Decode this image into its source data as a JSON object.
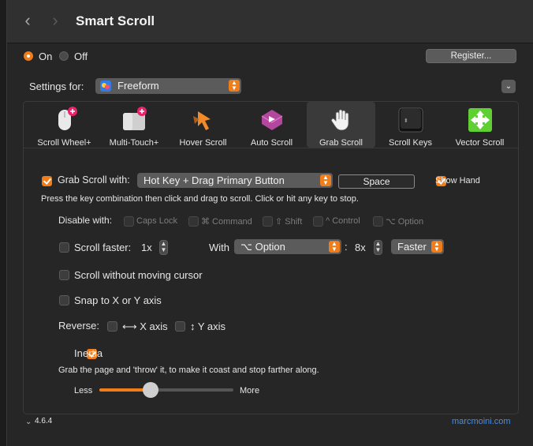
{
  "window": {
    "title": "Smart Scroll"
  },
  "nav": {
    "back": "‹",
    "forward": "›"
  },
  "power": {
    "on_label": "On",
    "off_label": "Off",
    "selected": "On"
  },
  "register_button": "Register...",
  "settings_for": {
    "label": "Settings for:",
    "app": "Freeform"
  },
  "tabs": [
    {
      "label": "Scroll Wheel+",
      "icon": "mouse-icon"
    },
    {
      "label": "Multi-Touch+",
      "icon": "trackpad-icon"
    },
    {
      "label": "Hover Scroll",
      "icon": "hover-arrow-icon"
    },
    {
      "label": "Auto Scroll",
      "icon": "auto-scroll-icon"
    },
    {
      "label": "Grab Scroll",
      "icon": "hand-icon",
      "selected": true
    },
    {
      "label": "Scroll Keys",
      "icon": "key-icon"
    },
    {
      "label": "Vector Scroll",
      "icon": "vector-arrows-icon"
    }
  ],
  "grab": {
    "enable_label": "Grab Scroll with:",
    "method": "Hot Key + Drag Primary Button",
    "hotkey": "Space",
    "show_hand_label": "Show Hand",
    "description": "Press the key combination then click and drag to scroll. Click or hit any key to stop."
  },
  "disable_with": {
    "label": "Disable with:",
    "options": [
      "Caps Lock",
      "⌘ Command",
      "⇧ Shift",
      "^ Control",
      "⌥ Option"
    ]
  },
  "scroll_faster": {
    "label": "Scroll faster:",
    "value": "1x",
    "with_label": "With",
    "modifier": "⌥ Option",
    "colon": ":",
    "multiplier": "8x",
    "mode": "Faster"
  },
  "no_cursor_label": "Scroll without moving cursor",
  "snap_label": "Snap to X or Y axis",
  "reverse": {
    "label": "Reverse:",
    "x_label": "⟷ X axis",
    "y_label": "↕ Y axis"
  },
  "inertia": {
    "label": "Inertia",
    "description": "Grab the page and 'throw' it, to make it coast and stop farther along.",
    "less": "Less",
    "more": "More",
    "level": 0.38
  },
  "footer": {
    "version": "4.6.4",
    "link": "marcmoini.com"
  },
  "colors": {
    "accent": "#f07d1a",
    "link": "#4a8de0"
  }
}
